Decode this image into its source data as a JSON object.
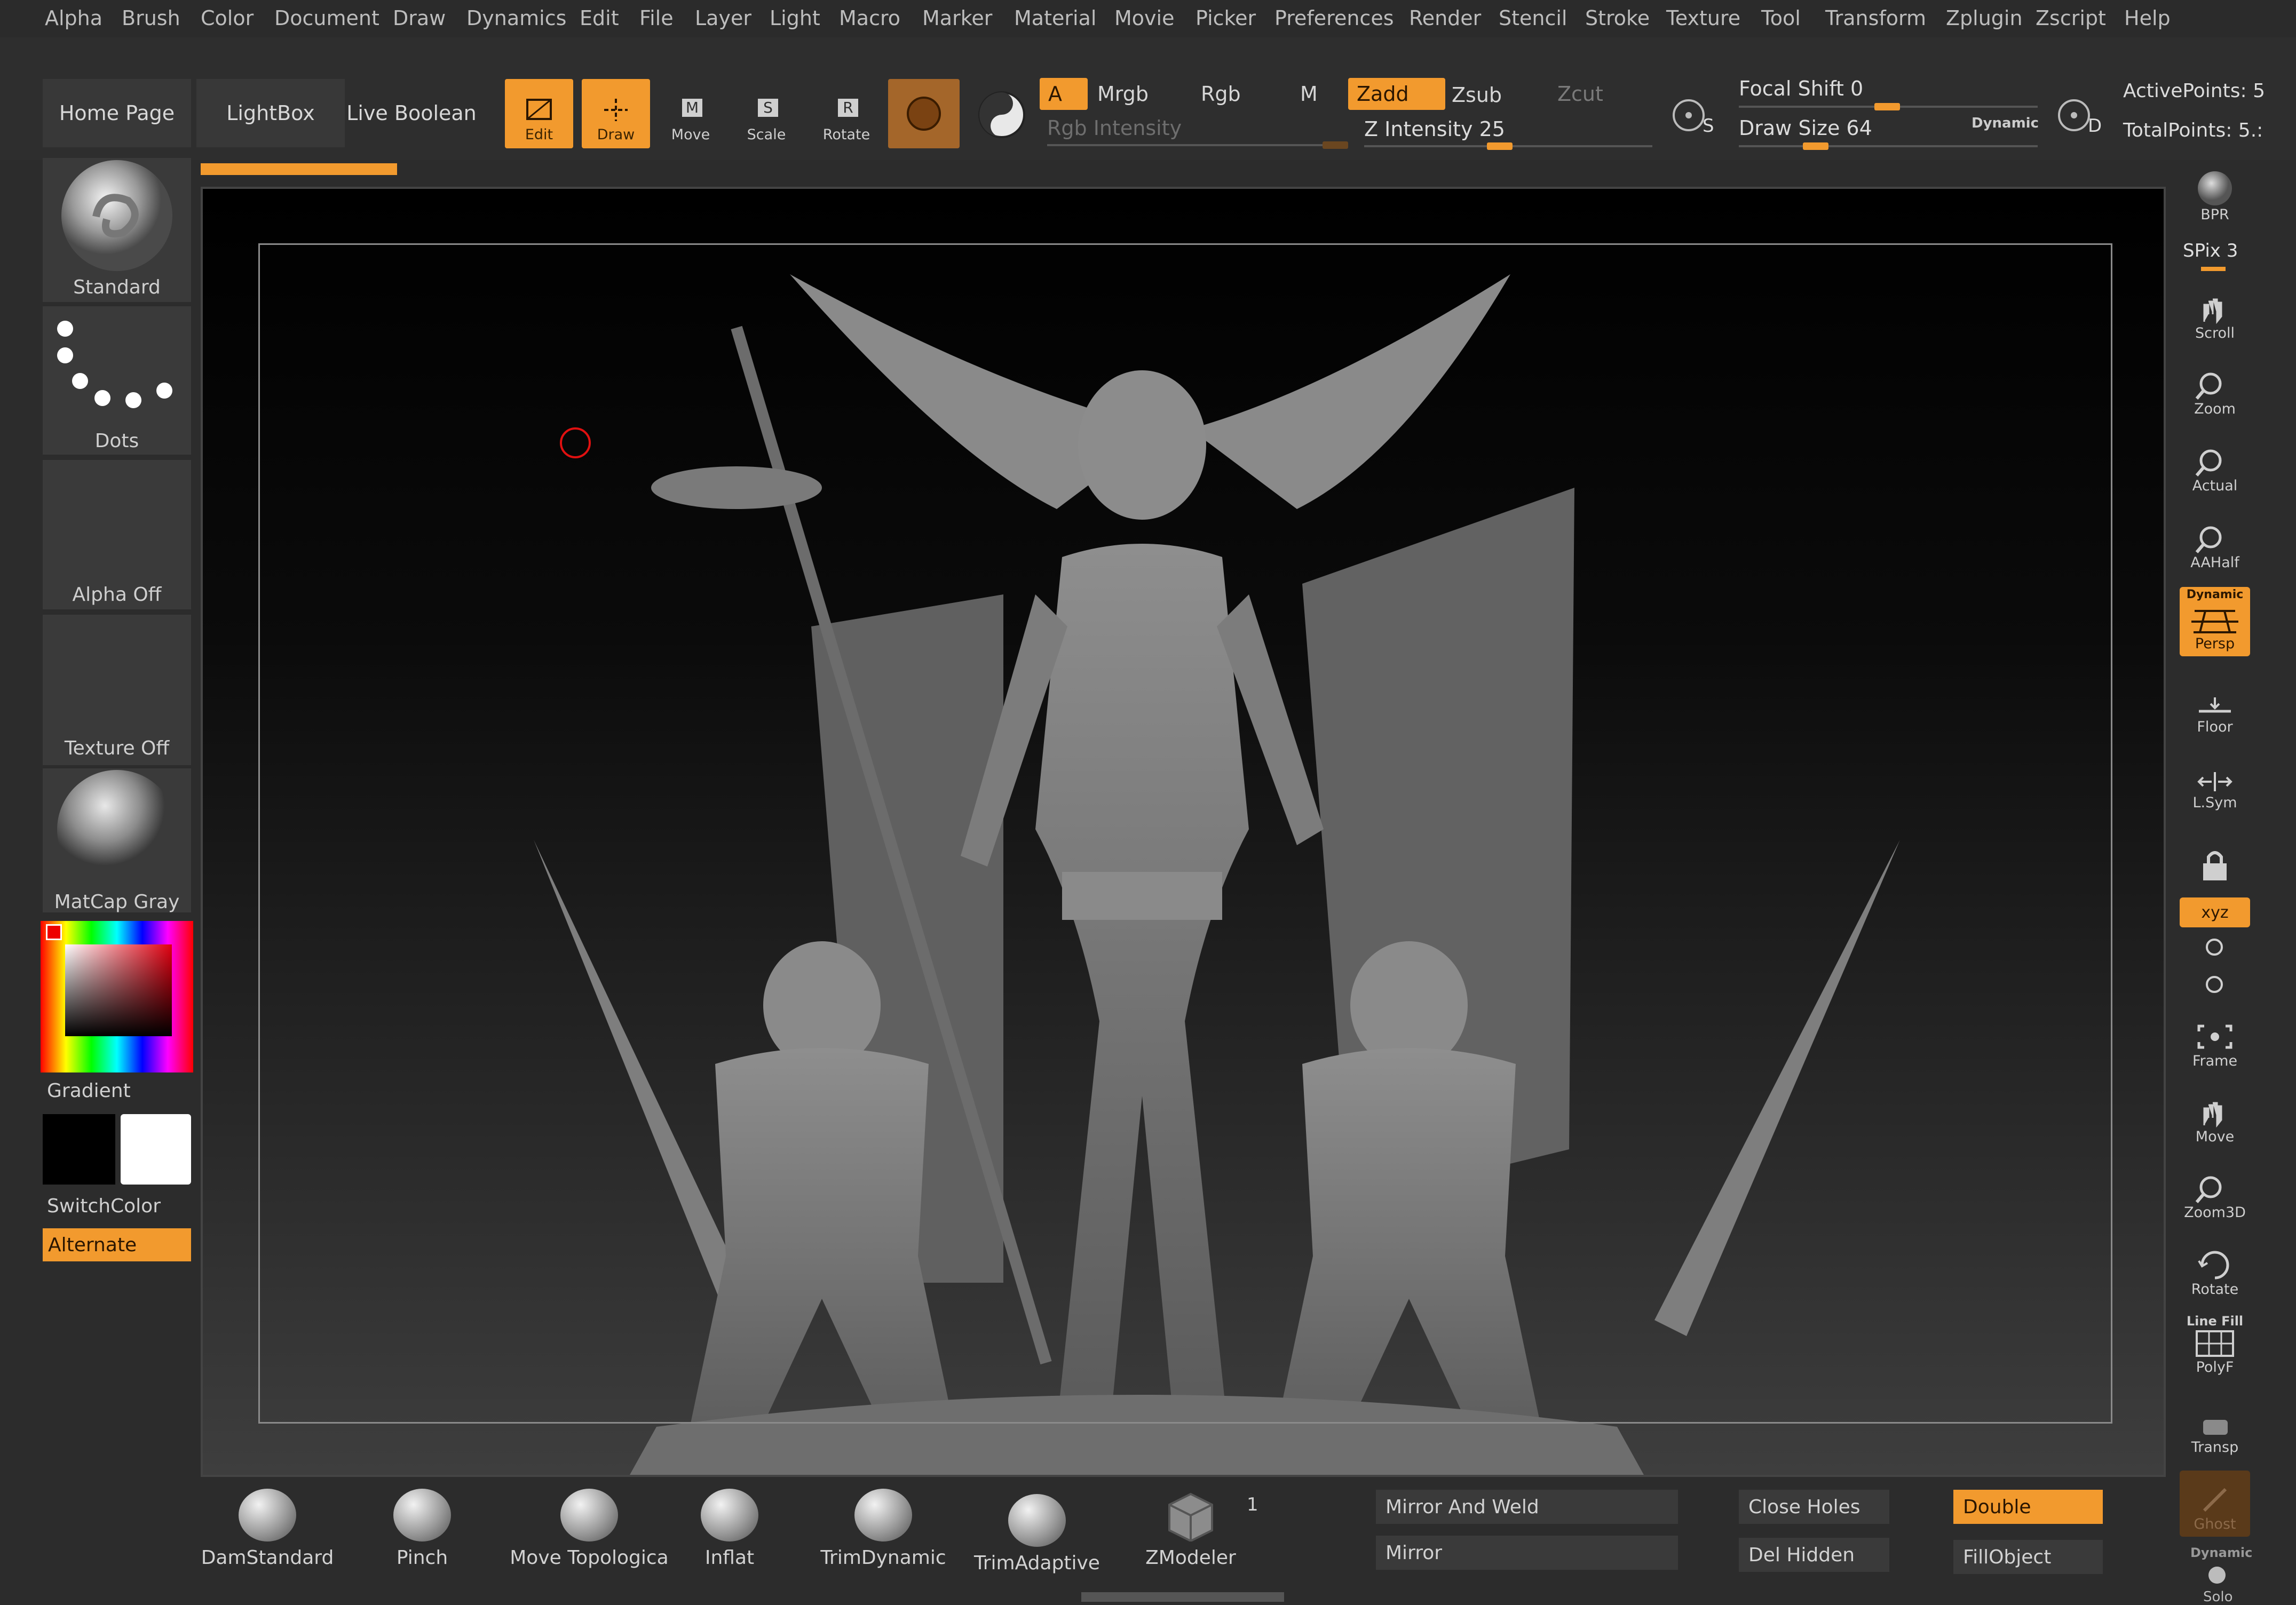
{
  "menu": [
    "Alpha",
    "Brush",
    "Color",
    "Document",
    "Draw",
    "Dynamics",
    "Edit",
    "File",
    "Layer",
    "Light",
    "Macro",
    "Marker",
    "Material",
    "Movie",
    "Picker",
    "Preferences",
    "Render",
    "Stencil",
    "Stroke",
    "Texture",
    "Tool",
    "Transform",
    "Zplugin",
    "Zscript",
    "Help"
  ],
  "tabs": {
    "home": "Home Page",
    "lightbox": "LightBox",
    "live_boolean": "Live Boolean"
  },
  "tools": {
    "edit": "Edit",
    "draw": "Draw",
    "move": "Move",
    "scale": "Scale",
    "rotate": "Rotate"
  },
  "modes": {
    "a": "A",
    "mrgb": "Mrgb",
    "rgb": "Rgb",
    "m": "M",
    "zadd": "Zadd",
    "zsub": "Zsub",
    "zcut": "Zcut"
  },
  "sliders": {
    "rgb_intensity": "Rgb Intensity",
    "z_intensity": "Z Intensity 25",
    "focal_shift": "Focal Shift 0",
    "draw_size": "Draw Size 64",
    "dynamic": "Dynamic",
    "s_label": "S",
    "d_label": "D"
  },
  "stats": {
    "active": "ActivePoints: 5",
    "total": "TotalPoints: 5.:"
  },
  "left": {
    "brush": "Standard",
    "stroke": "Dots",
    "alpha": "Alpha Off",
    "texture": "Texture Off",
    "material": "MatCap Gray",
    "gradient": "Gradient",
    "switch_color": "SwitchColor",
    "alternate": "Alternate"
  },
  "right": {
    "bpr": "BPR",
    "spix": "SPix 3",
    "scroll": "Scroll",
    "zoom": "Zoom",
    "actual": "Actual",
    "aahalf": "AAHalf",
    "persp_top": "Dynamic",
    "persp": "Persp",
    "floor": "Floor",
    "lsym": "L.Sym",
    "xyz": "xyz",
    "frame": "Frame",
    "move": "Move",
    "zoom3d": "Zoom3D",
    "rotate": "Rotate",
    "linefill_top": "Line Fill",
    "polyf": "PolyF",
    "transp": "Transp",
    "ghost": "Ghost",
    "solo_top": "Dynamic",
    "solo": "Solo"
  },
  "bottom": {
    "brushes": [
      "DamStandard",
      "Pinch",
      "Move Topologica",
      "Inflat",
      "TrimDynamic",
      "TrimAdaptive",
      "ZModeler"
    ],
    "zmodeler_count": "1",
    "mirror_weld": "Mirror And Weld",
    "mirror": "Mirror",
    "close_holes": "Close Holes",
    "del_hidden": "Del Hidden",
    "double": "Double",
    "fill_object": "FillObject"
  },
  "colors": {
    "accent": "#f29a2e",
    "bg": "#2c2c2c",
    "panel": "#3a3a3a"
  }
}
